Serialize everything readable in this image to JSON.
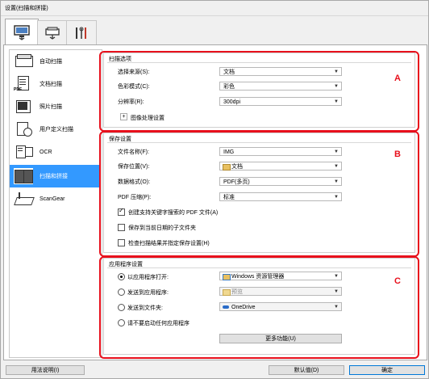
{
  "window": {
    "title": "设置(扫描和拼接)"
  },
  "tabs": [
    {
      "icon": "computer-scan-icon"
    },
    {
      "icon": "scanner-network-icon"
    },
    {
      "icon": "tools-icon"
    }
  ],
  "sidebar": {
    "items": [
      {
        "label": "自动扫描",
        "icon": "auto-scan-icon"
      },
      {
        "label": "文档扫描",
        "icon": "document-scan-icon"
      },
      {
        "label": "照片扫描",
        "icon": "photo-scan-icon"
      },
      {
        "label": "用户定义扫描",
        "icon": "custom-scan-icon"
      },
      {
        "label": "OCR",
        "icon": "ocr-icon"
      },
      {
        "label": "扫描和拼接",
        "icon": "stitch-icon",
        "selected": true
      },
      {
        "label": "ScanGear",
        "icon": "scangear-icon"
      }
    ]
  },
  "scan_options": {
    "header": "扫描选项",
    "marker": "A",
    "source_label": "选择来源(S):",
    "source_value": "文档",
    "color_label": "色彩模式(C):",
    "color_value": "彩色",
    "resolution_label": "分辨率(R):",
    "resolution_value": "300dpi",
    "image_processing_label": "图像处理设置",
    "expand_symbol": "+"
  },
  "save_settings": {
    "header": "保存设置",
    "marker": "B",
    "filename_label": "文件名称(F):",
    "filename_value": "IMG",
    "location_label": "保存位置(V):",
    "location_value": "文档",
    "format_label": "数据格式(O):",
    "format_value": "PDF(多页)",
    "compression_label": "PDF 压缩(P):",
    "compression_value": "标准",
    "cb_keyword_pdf": "创建支持关键字搜索的 PDF 文件(A)",
    "cb_date_folder": "保存到当前日期的子文件夹",
    "cb_check_results": "检查扫描结果并指定保存设置(H)"
  },
  "app_settings": {
    "header": "应用程序设置",
    "marker": "C",
    "radio_open_with": "以应用程序打开:",
    "open_with_value": "Windows 资源管理器",
    "radio_send_app": "发送到应用程序:",
    "send_app_value": "预览",
    "radio_send_folder": "发送到文件夹:",
    "send_folder_value": "OneDrive",
    "radio_no_launch": "请不要启动任何应用程序",
    "more_functions": "更多功能(U)"
  },
  "footer": {
    "help": "用法说明(I)",
    "defaults": "默认值(D)",
    "ok": "确定"
  },
  "colors": {
    "accent": "#3399ff",
    "marker": "#e8101c"
  }
}
